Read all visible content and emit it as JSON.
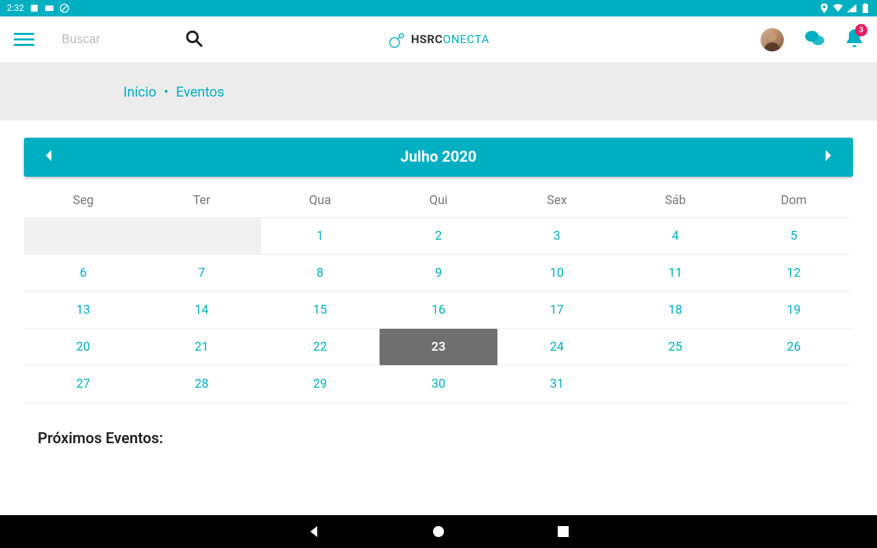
{
  "status_bar": {
    "time": "2:32"
  },
  "header": {
    "search_placeholder": "Buscar",
    "logo_bold": "HSRC",
    "logo_light": "ONECTA",
    "notification_count": "3"
  },
  "breadcrumb": {
    "home": "Início",
    "current": "Eventos"
  },
  "calendar": {
    "title": "Julho 2020",
    "weekdays": [
      "Seg",
      "Ter",
      "Qua",
      "Qui",
      "Sex",
      "Sáb",
      "Dom"
    ],
    "weeks": [
      [
        {
          "d": "",
          "empty": true
        },
        {
          "d": "",
          "empty": true
        },
        {
          "d": "1"
        },
        {
          "d": "2"
        },
        {
          "d": "3"
        },
        {
          "d": "4"
        },
        {
          "d": "5"
        }
      ],
      [
        {
          "d": "6"
        },
        {
          "d": "7"
        },
        {
          "d": "8"
        },
        {
          "d": "9"
        },
        {
          "d": "10"
        },
        {
          "d": "11"
        },
        {
          "d": "12"
        }
      ],
      [
        {
          "d": "13"
        },
        {
          "d": "14"
        },
        {
          "d": "15"
        },
        {
          "d": "16"
        },
        {
          "d": "17"
        },
        {
          "d": "18"
        },
        {
          "d": "19"
        }
      ],
      [
        {
          "d": "20"
        },
        {
          "d": "21"
        },
        {
          "d": "22"
        },
        {
          "d": "23",
          "today": true
        },
        {
          "d": "24"
        },
        {
          "d": "25"
        },
        {
          "d": "26"
        }
      ],
      [
        {
          "d": "27"
        },
        {
          "d": "28"
        },
        {
          "d": "29"
        },
        {
          "d": "30"
        },
        {
          "d": "31"
        },
        {
          "d": ""
        },
        {
          "d": ""
        }
      ]
    ]
  },
  "upcoming_title": "Próximos Eventos:"
}
